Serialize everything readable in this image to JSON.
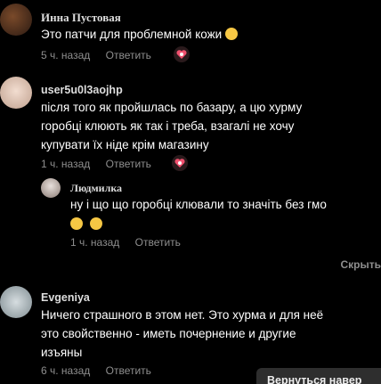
{
  "comments": [
    {
      "author": "Инна Пустовая",
      "text": "Это патчи для проблемной кожи",
      "time": "5 ч. назад",
      "reply": "Ответить"
    },
    {
      "author": "user5u0l3aojhp",
      "lines": [
        "після того як пройшлась по базару, а цю хурму",
        "горобці клюють як так і треба, взагалі не хочу",
        "купувати їх ніде крім магазину"
      ],
      "time": "1 ч. назад",
      "reply": "Ответить",
      "replies": [
        {
          "author": "Людмилка",
          "text": "ну і що що горобці клювали то значіть без гмо",
          "time": "1 ч. назад",
          "reply": "Ответить"
        }
      ]
    },
    {
      "author": "Evgeniya",
      "lines": [
        "Ничего страшного в этом нет. Это хурма и для неё",
        "это свойственно - иметь почернение и другие",
        "изъяны"
      ],
      "time": "6 ч. назад",
      "reply": "Ответить"
    }
  ],
  "hide_label": "Скрыть",
  "toast_label": "Вернуться навер"
}
